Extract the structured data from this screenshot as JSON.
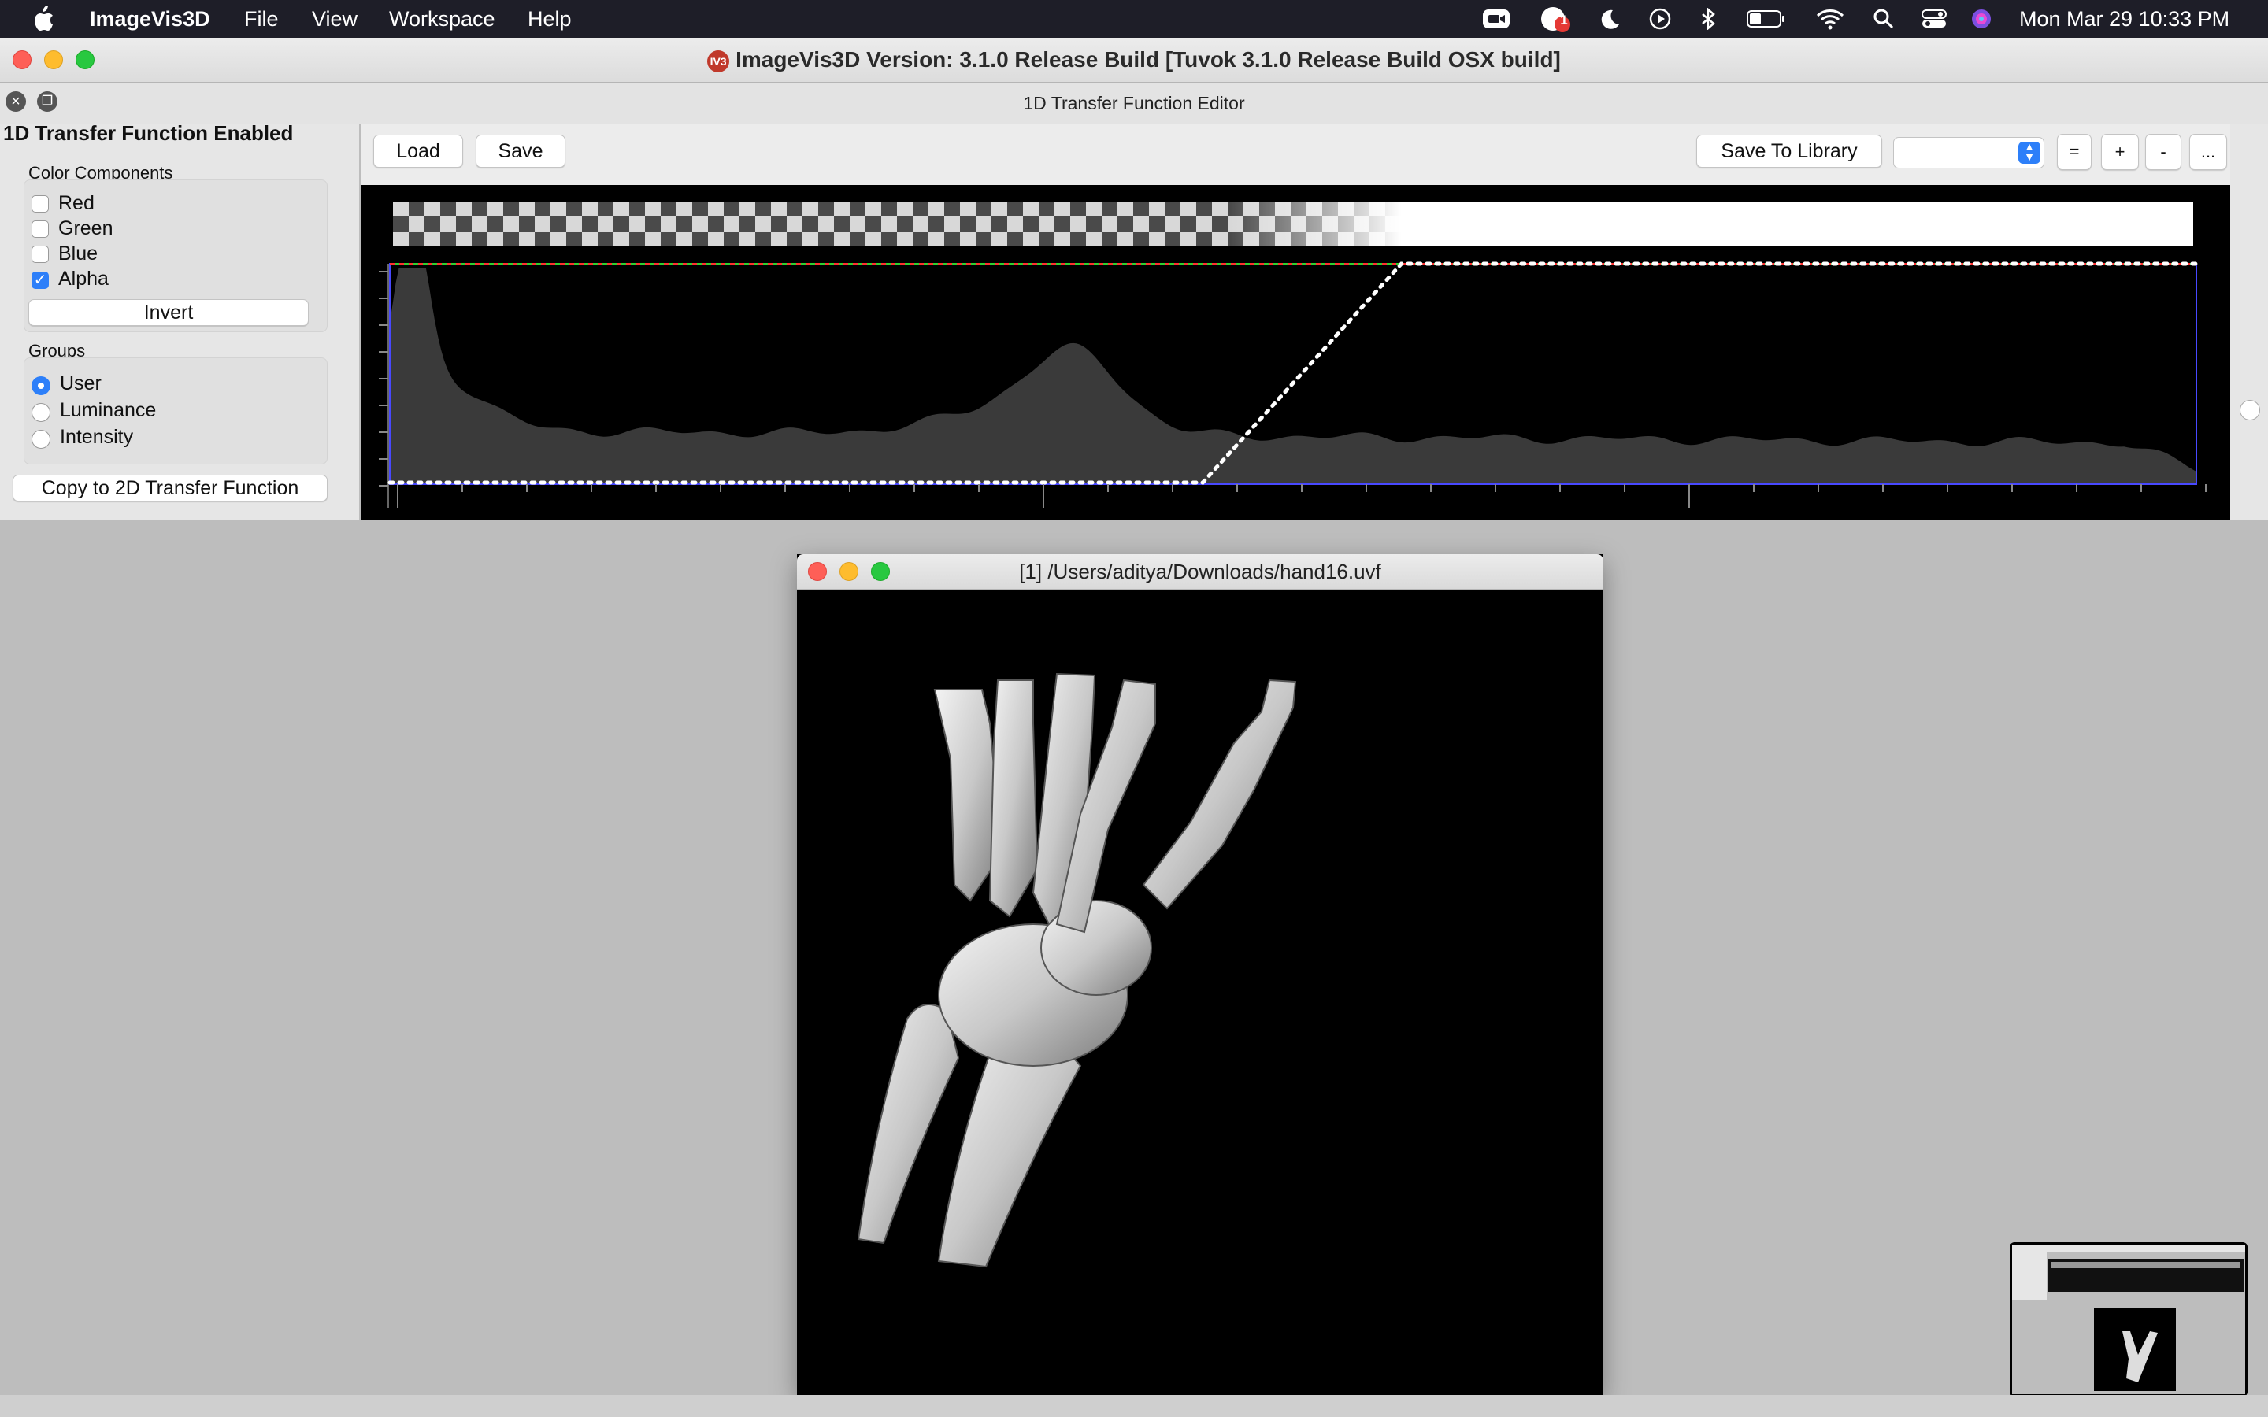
{
  "menubar": {
    "app_name": "ImageVis3D",
    "items": [
      "File",
      "View",
      "Workspace",
      "Help"
    ],
    "clock": "Mon Mar 29  10:33 PM",
    "notification_count": "1",
    "icons": [
      "zoom-icon",
      "notification-icon",
      "do-not-disturb-icon",
      "play-icon",
      "bluetooth-icon",
      "battery-icon",
      "wifi-icon",
      "spotlight-search-icon",
      "control-center-icon",
      "siri-icon"
    ]
  },
  "window": {
    "title": "ImageVis3D Version: 3.1.0 Release Build [Tuvok 3.1.0 Release Build OSX build]",
    "app_icon_text": "IV3"
  },
  "tf_editor": {
    "dock_title": "1D Transfer Function Editor",
    "enabled_label": "1D Transfer Function Enabled",
    "color_components": {
      "title": "Color Components",
      "items": [
        {
          "label": "Red",
          "checked": false
        },
        {
          "label": "Green",
          "checked": false
        },
        {
          "label": "Blue",
          "checked": false
        },
        {
          "label": "Alpha",
          "checked": true
        }
      ]
    },
    "invert_label": "Invert",
    "groups": {
      "title": "Groups",
      "items": [
        {
          "label": "User",
          "selected": true
        },
        {
          "label": "Luminance",
          "selected": false
        },
        {
          "label": "Intensity",
          "selected": false
        }
      ]
    },
    "copy_label": "Copy to 2D Transfer Function",
    "toolbar": {
      "load_label": "Load",
      "save_label": "Save",
      "save_library_label": "Save To Library",
      "library_selected": "",
      "equal_label": "=",
      "plus_label": "+",
      "minus_label": "-",
      "more_label": "..."
    },
    "transfer_function": {
      "x_range": [
        0,
        1
      ],
      "alpha_curve": [
        [
          0,
          0
        ],
        [
          0.45,
          0
        ],
        [
          0.56,
          1
        ],
        [
          1,
          1
        ]
      ],
      "colors": {
        "histogram": "#3a3a3a",
        "curve": "#ffffff",
        "border": "#4848ff"
      }
    }
  },
  "render_window": {
    "title": "[1] /Users/aditya/Downloads/hand16.uvf",
    "content": "volume-rendering-hand-bones"
  }
}
